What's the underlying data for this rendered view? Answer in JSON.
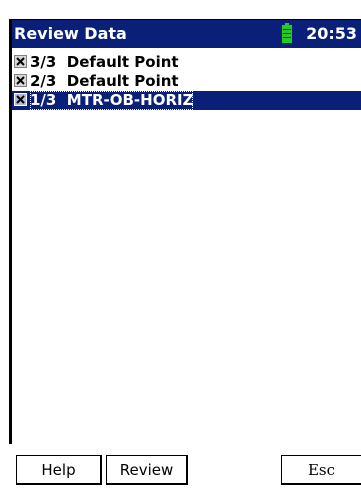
{
  "titlebar": {
    "title": "Review Data",
    "time": "20:53",
    "battery_color": "#22cc22"
  },
  "list": {
    "items": [
      {
        "checked": true,
        "label": "3/3  Default Point",
        "selected": false
      },
      {
        "checked": true,
        "label": "2/3  Default Point",
        "selected": false
      },
      {
        "checked": true,
        "label": "1/3  MTR-OB-HORIZ",
        "selected": true
      }
    ]
  },
  "softkeys": {
    "help": "Help",
    "review": "Review",
    "esc": "Esc"
  },
  "colors": {
    "titlebar_bg": "#0a1f78",
    "selection_bg": "#0a1f78"
  }
}
